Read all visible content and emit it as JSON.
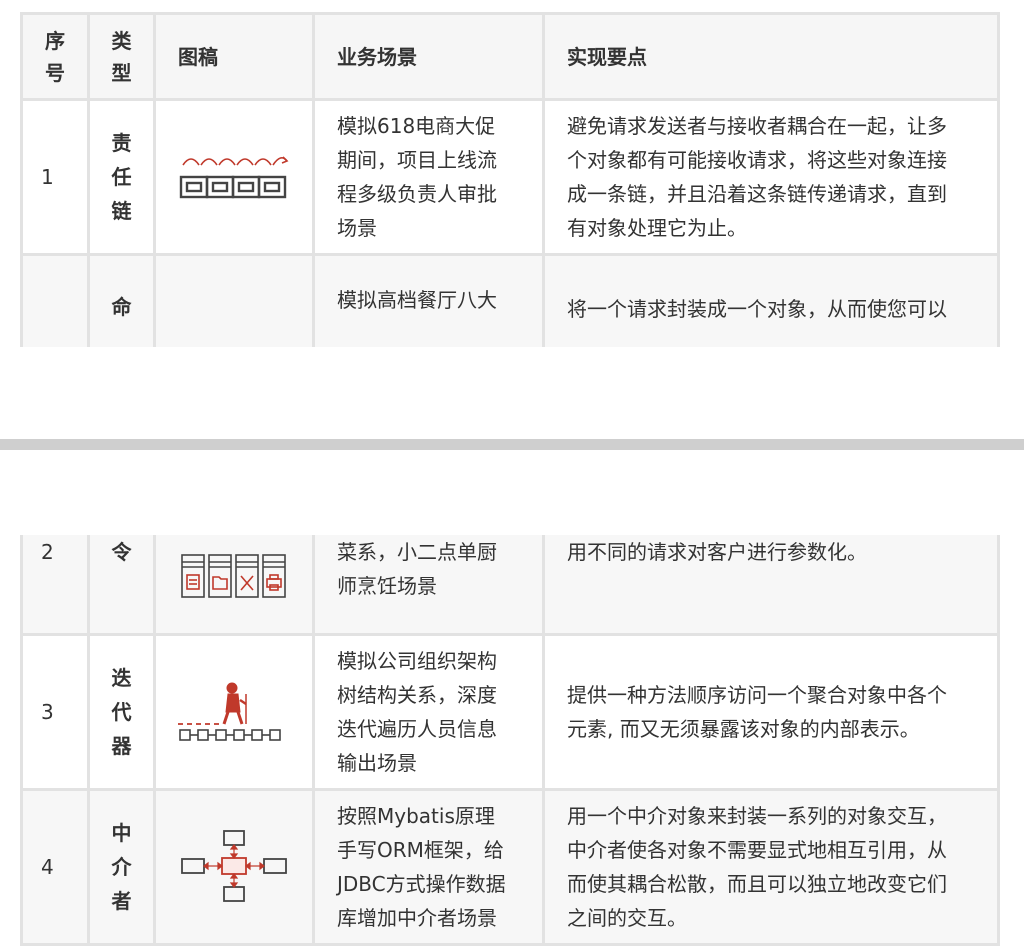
{
  "header": {
    "col_index": [
      "序",
      "号"
    ],
    "col_type": [
      "类",
      "型"
    ],
    "col_diagram": "图稿",
    "col_scenario": "业务场景",
    "col_points": "实现要点"
  },
  "rows": [
    {
      "index": "1",
      "type_chars": [
        "责",
        "任",
        "链"
      ],
      "icon": "chain-icon",
      "scenario": [
        "模拟618电商大促",
        "期间，项目上线流",
        "程多级负责人审批",
        "场景"
      ],
      "points": [
        "避免请求发送者与接收者耦合在一起，让多",
        "个对象都有可能接收请求，将这些对象连接",
        "成一条链，并且沿着这条链传递请求，直到",
        "有对象处理它为止。"
      ]
    },
    {
      "index": "2",
      "type_chars": [
        "命",
        "令"
      ],
      "icon": "command-panels-icon",
      "scenario": [
        "模拟高档餐厅八大",
        "菜系，小二点单厨",
        "师烹饪场景"
      ],
      "points": [
        "将一个请求封装成一个对象，从而使您可以",
        "用不同的请求对客户进行参数化。"
      ]
    },
    {
      "index": "3",
      "type_chars": [
        "迭",
        "代",
        "器"
      ],
      "icon": "walker-icon",
      "scenario": [
        "模拟公司组织架构",
        "树结构关系，深度",
        "迭代遍历人员信息",
        "输出场景"
      ],
      "points": [
        "提供一种方法顺序访问一个聚合对象中各个",
        "元素, 而又无须暴露该对象的内部表示。"
      ]
    },
    {
      "index": "4",
      "type_chars": [
        "中",
        "介",
        "者"
      ],
      "icon": "mediator-icon",
      "scenario": [
        "按照Mybatis原理",
        "手写ORM框架，给",
        "JDBC方式操作数据",
        "库增加中介者场景"
      ],
      "points": [
        "用一个中介对象来封装一系列的对象交互，",
        "中介者使各对象不需要显式地相互引用，从",
        "而使其耦合松散，而且可以独立地改变它们",
        "之间的交互。"
      ]
    }
  ]
}
